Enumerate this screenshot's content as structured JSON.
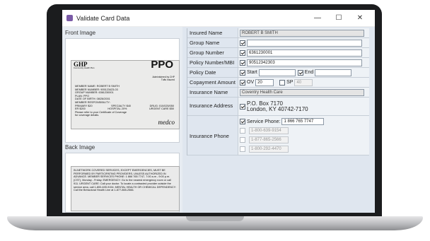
{
  "window": {
    "title": "Validate Card Data",
    "minimize": "—",
    "maximize": "☐",
    "close": "✕"
  },
  "front": {
    "label": "Front Image",
    "logo": "GHP",
    "logo_sub": "Community Health Plan",
    "plan_type": "PPO",
    "administered": "Administered by CHP",
    "administered2": "Tufts Insured",
    "lines": [
      "MEMBER NAME: ROBERT B SMITH",
      "MEMBER NUMBER: 905123423-03",
      "GROUP NUMBER: 6361230001",
      "PLAN: PPO",
      "DATE OF BIRTH: 08/26/2001",
      "MEMBER RESPONSIBILITY:"
    ],
    "copays": [
      {
        "a": "PRIMARY $20",
        "b": "SPECIALTY $40",
        "c": "DRUG: 010/025/050"
      },
      {
        "a": "ER $200",
        "b": "HOSPITAL 20%",
        "c": "URGENT CARE $50"
      }
    ],
    "footer1": "Please refer to your Certificate of Coverage",
    "footer2": "for coverage details.",
    "medco": "medco"
  },
  "back": {
    "label": "Back Image",
    "text": "IN-NETWORK COVERED SERVICES, EXCEPT EMERGENCIES, MUST BE PERFORMED BY PARTICIPATING PROVIDERS, UNLESS AUTHORIZED IN ADVANCE. MEMBER SERVICES PHONE: 1 866 765 7747, 7:00 a.m - 9:00 p.m. (CST), Monday - Friday. EMERGENCY: Go to the nearest emergency room or call 911. URGENT CARE: Call your doctor. To locate a contracted provider outside the service area, call 1-800-639-9154. MENTAL HEALTH OR CHEMICAL DEPENDENCY: Call the Behavioral Health Line at 1-877-865-2566."
  },
  "fields": {
    "insured_name": {
      "label": "Insured Name",
      "value": "ROBERT B SMITH"
    },
    "group_name": {
      "label": "Group Name",
      "value": ""
    },
    "group_number": {
      "label": "Group Number",
      "value": "6361230001"
    },
    "policy_number": {
      "label": "Policy Number/MBI",
      "value": "90512342303"
    },
    "policy_date": {
      "label": "Policy Date",
      "start_label": "Start",
      "start": "",
      "end_label": "End",
      "end": ""
    },
    "copayment": {
      "label": "Copayment Amount",
      "ov_label": "OV",
      "ov": "20",
      "sp_label": "SP",
      "sp": "40"
    },
    "insurance_name": {
      "label": "Insurance Name",
      "value": "Coventry Health Care"
    },
    "insurance_address": {
      "label": "Insurance Address",
      "line1": "P.O. Box 7170",
      "line2": "London, KY 40742-7170"
    },
    "insurance_phone": {
      "label": "Insurance Phone",
      "service_label": "Service Phone:",
      "service": "1 866 765 7747",
      "others": [
        "1-800-639-9154",
        "1-877-865-2566",
        "1-800-292-4470"
      ]
    }
  }
}
